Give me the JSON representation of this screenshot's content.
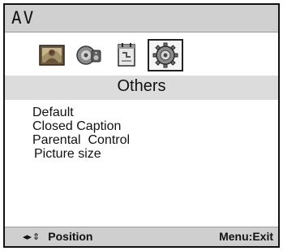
{
  "header": {
    "title": "AV"
  },
  "tabs": [
    {
      "icon": "picture-icon",
      "selected": false
    },
    {
      "icon": "sound-icon",
      "selected": false
    },
    {
      "icon": "time-icon",
      "selected": false
    },
    {
      "icon": "gear-icon",
      "selected": true
    }
  ],
  "section": {
    "title": "Others"
  },
  "menu": {
    "items": [
      {
        "label": "Default"
      },
      {
        "label": "Closed Caption"
      },
      {
        "label": "Parental  Control"
      },
      {
        "label": "Picture size"
      }
    ]
  },
  "footer": {
    "lr_arrow_icon": "◂▸",
    "ud_arrow_icon": "⇕",
    "position_label": "Position",
    "exit_label": "Menu:Exit"
  },
  "colors": {
    "title_bar": "#d0d0d0",
    "section_bar": "#dcdcdc",
    "footer_bar": "#cfcfcf",
    "frame": "#111111"
  }
}
